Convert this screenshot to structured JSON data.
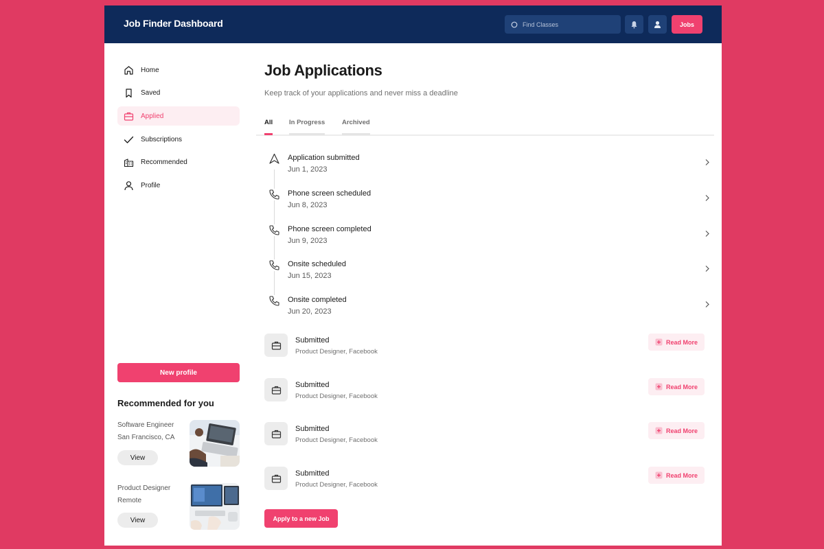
{
  "header": {
    "title": "Job Finder Dashboard",
    "search_placeholder": "Find Classes",
    "jobs_label": "Jobs",
    "icons": [
      "bell-icon",
      "user-icon",
      "search-icon"
    ]
  },
  "sidebar": {
    "items": [
      {
        "label": "Home",
        "icon": "home-icon",
        "active": false
      },
      {
        "label": "Saved",
        "icon": "bookmark-icon",
        "active": false
      },
      {
        "label": "Applied",
        "icon": "briefcase-icon",
        "active": true
      },
      {
        "label": "Subscriptions",
        "icon": "check-icon",
        "active": false
      },
      {
        "label": "Recommended",
        "icon": "buildings-icon",
        "active": false
      },
      {
        "label": "Profile",
        "icon": "user-icon",
        "active": false
      }
    ],
    "new_profile_label": "New profile",
    "recommended_title": "Recommended for you",
    "recommended": [
      {
        "role": "Software Engineer",
        "location": "San Francisco, CA",
        "button": "View"
      },
      {
        "role": "Product Designer",
        "location": "Remote",
        "button": "View"
      }
    ]
  },
  "main": {
    "title": "Job Applications",
    "subtitle": "Keep track of your applications and never miss a deadline",
    "tabs": [
      {
        "label": "All",
        "active": true
      },
      {
        "label": "In Progress",
        "active": false
      },
      {
        "label": "Archived",
        "active": false
      }
    ],
    "timeline": [
      {
        "title": "Application submitted",
        "date": "Jun 1, 2023",
        "icon": "send-icon"
      },
      {
        "title": "Phone screen scheduled",
        "date": "Jun 8, 2023",
        "icon": "phone-icon"
      },
      {
        "title": "Phone screen completed",
        "date": "Jun 9, 2023",
        "icon": "phone-icon"
      },
      {
        "title": "Onsite scheduled",
        "date": "Jun 15, 2023",
        "icon": "phone-icon"
      },
      {
        "title": "Onsite completed",
        "date": "Jun 20, 2023",
        "icon": "phone-icon"
      }
    ],
    "applications": [
      {
        "status": "Submitted",
        "role": "Product Designer, Facebook",
        "action": "Read More"
      },
      {
        "status": "Submitted",
        "role": "Product Designer, Facebook",
        "action": "Read More"
      },
      {
        "status": "Submitted",
        "role": "Product Designer, Facebook",
        "action": "Read More"
      },
      {
        "status": "Submitted",
        "role": "Product Designer, Facebook",
        "action": "Read More"
      }
    ],
    "apply_label": "Apply to a new Job"
  },
  "colors": {
    "background": "#e03a62",
    "header": "#0e2a5a",
    "accent": "#f0416f",
    "accent_soft": "#fdeef2"
  }
}
